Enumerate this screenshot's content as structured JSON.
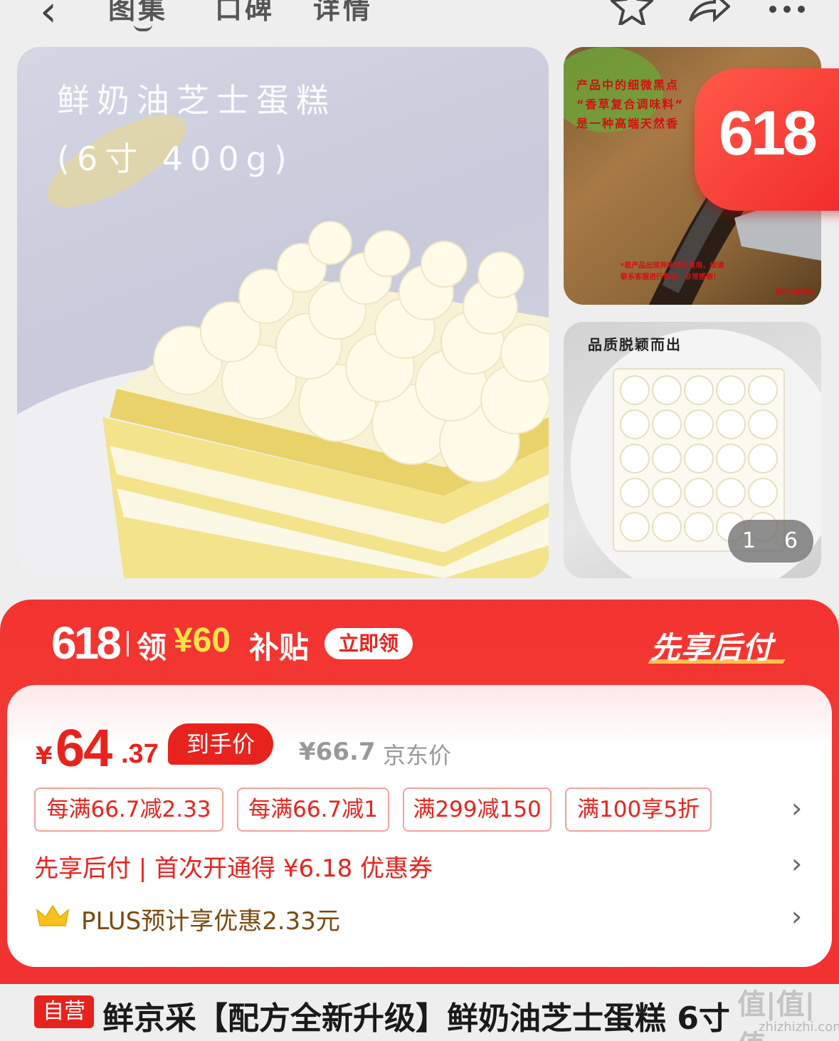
{
  "nav": {
    "back_icon": "‹",
    "tabs": [
      "图集",
      "口碑",
      "详情"
    ],
    "icons": [
      "star-icon",
      "share-icon",
      "more-icon"
    ]
  },
  "gallery": {
    "main_title_line1": "鲜奶油芝士蛋糕",
    "main_title_line2": "(6寸 400g)",
    "thumb1_text": [
      "产品中的细微黑点",
      "“香草复合调味料”",
      "是一种高端天然香"
    ],
    "thumb1_note": [
      "*若产品出现异味请勿食用，烦请",
      "联系客服进行售后，非常感谢！"
    ],
    "thumb1_caption": "图示为香草籽",
    "thumb2_text": "品质脱颖而出",
    "badge": "618",
    "pager_current": "1",
    "pager_total": "6"
  },
  "promo": {
    "event": "618",
    "claim_prefix": "领",
    "claim_amount": "¥60",
    "claim_suffix": "补贴",
    "claim_button": "立即领",
    "pay_later": "先享后付"
  },
  "price": {
    "currency": "¥",
    "integer": "64",
    "decimal": ".37",
    "final_label": "到手价",
    "jd_price": "¥66.7",
    "jd_label": "京东价",
    "coupons": [
      "每满66.7减2.33",
      "每满66.7减1",
      "满299减150",
      "满100享5折"
    ],
    "pay_later_line": "先享后付 | 首次开通得 ¥6.18 优惠券",
    "plus_line": "PLUS预计享优惠2.33元",
    "arrow": "›"
  },
  "product": {
    "self_operated": "自营",
    "title": "鲜京采【配方全新升级】鲜奶油芝士蛋糕 6寸"
  },
  "watermark": {
    "logo": "值|值|值",
    "site": "zhizhizhi.com"
  },
  "colors": {
    "accent": "#e8231d",
    "promo_bg": "#f43330",
    "highlight": "#ffe24a"
  }
}
